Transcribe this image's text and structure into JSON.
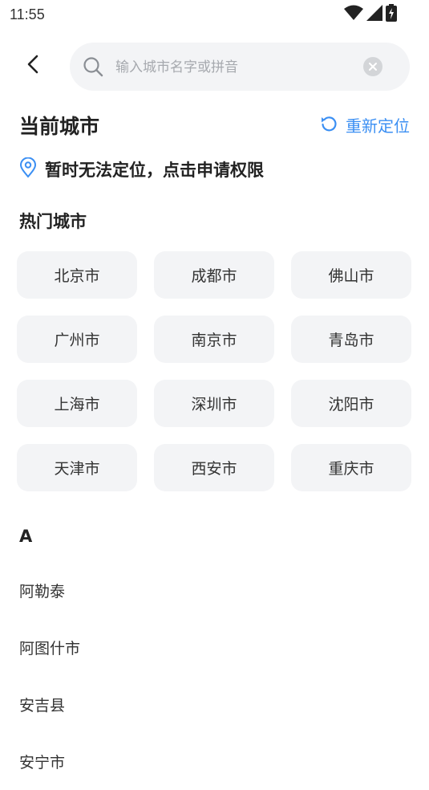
{
  "status_bar": {
    "time": "11:55",
    "icons": [
      "wifi-icon",
      "cellular-signal-icon",
      "battery-charging-icon"
    ]
  },
  "search": {
    "placeholder": "输入城市名字或拼音",
    "value": ""
  },
  "current_city": {
    "title": "当前城市",
    "relocate_label": "重新定位",
    "location_message": "暂时无法定位，点击申请权限"
  },
  "hot_cities": {
    "title": "热门城市",
    "cities": [
      "北京市",
      "成都市",
      "佛山市",
      "广州市",
      "南京市",
      "青岛市",
      "上海市",
      "深圳市",
      "沈阳市",
      "天津市",
      "西安市",
      "重庆市"
    ]
  },
  "city_index": {
    "letter": "A",
    "cities": [
      "阿勒泰",
      "阿图什市",
      "安吉县",
      "安宁市"
    ]
  },
  "colors": {
    "accent": "#3b8ff3",
    "chip_background": "#f3f4f6",
    "text_primary": "#222222"
  }
}
